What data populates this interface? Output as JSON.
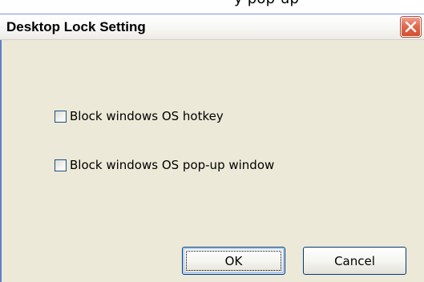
{
  "background_text": "y pop-up",
  "dialog": {
    "title": "Desktop Lock Setting",
    "close_icon": "close-icon",
    "options": [
      {
        "label": "Block windows OS hotkey",
        "checked": false
      },
      {
        "label": "Block windows OS pop-up window",
        "checked": false
      }
    ],
    "buttons": {
      "ok_label": "OK",
      "cancel_label": "Cancel"
    }
  },
  "colors": {
    "dialog_face": "#ece9d8",
    "close_button": "#d0502f",
    "frame_blue": "#5f7fc8"
  }
}
